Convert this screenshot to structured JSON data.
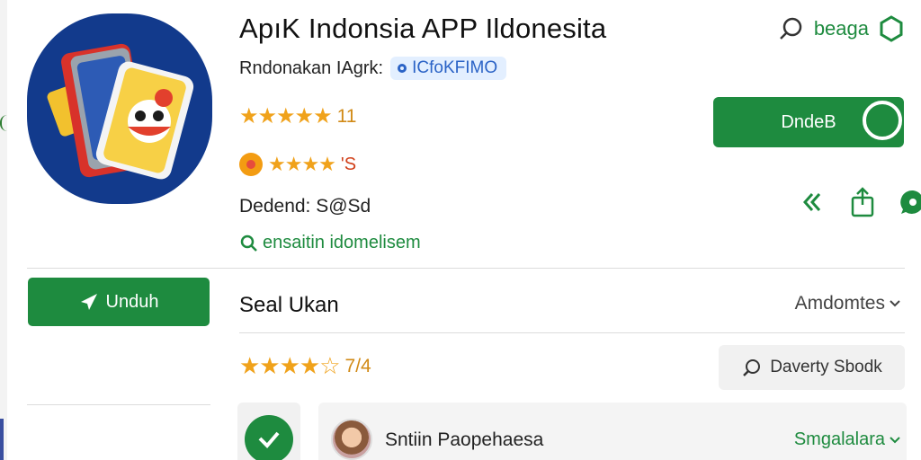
{
  "app": {
    "title": "ApıK Indonsia APP Ildonesita",
    "developer": "Rndonakan IAgrk:",
    "developer_badge": "ICfoKFIMO",
    "rating_primary": "11",
    "rating_secondary": "'S",
    "downloads": "Dedend: S@Sd",
    "green_link": "ensaitin idomelisem"
  },
  "top_right": {
    "label": "beaga"
  },
  "install_button": {
    "label": "DndeB"
  },
  "download_button": {
    "label": "Unduh"
  },
  "reviews": {
    "section_title": "Seal Ukan",
    "sort_label": "Amdomtes",
    "summary_rating": "7/4",
    "write_review_label": "Daverty Sbodk",
    "first_reviewer": "Sntiin Paopehaesa",
    "first_reviewer_filter": "Smgalalara"
  },
  "colors": {
    "brand_green": "#1e8b3f",
    "star": "#f0a21b",
    "icon_bg": "#123a8c"
  },
  "icons": [
    "search-icon",
    "settings-gear-icon",
    "share-icon",
    "back-chevrons-icon",
    "chat-icon",
    "send-icon",
    "pencil-review-icon",
    "checkmark-icon"
  ]
}
